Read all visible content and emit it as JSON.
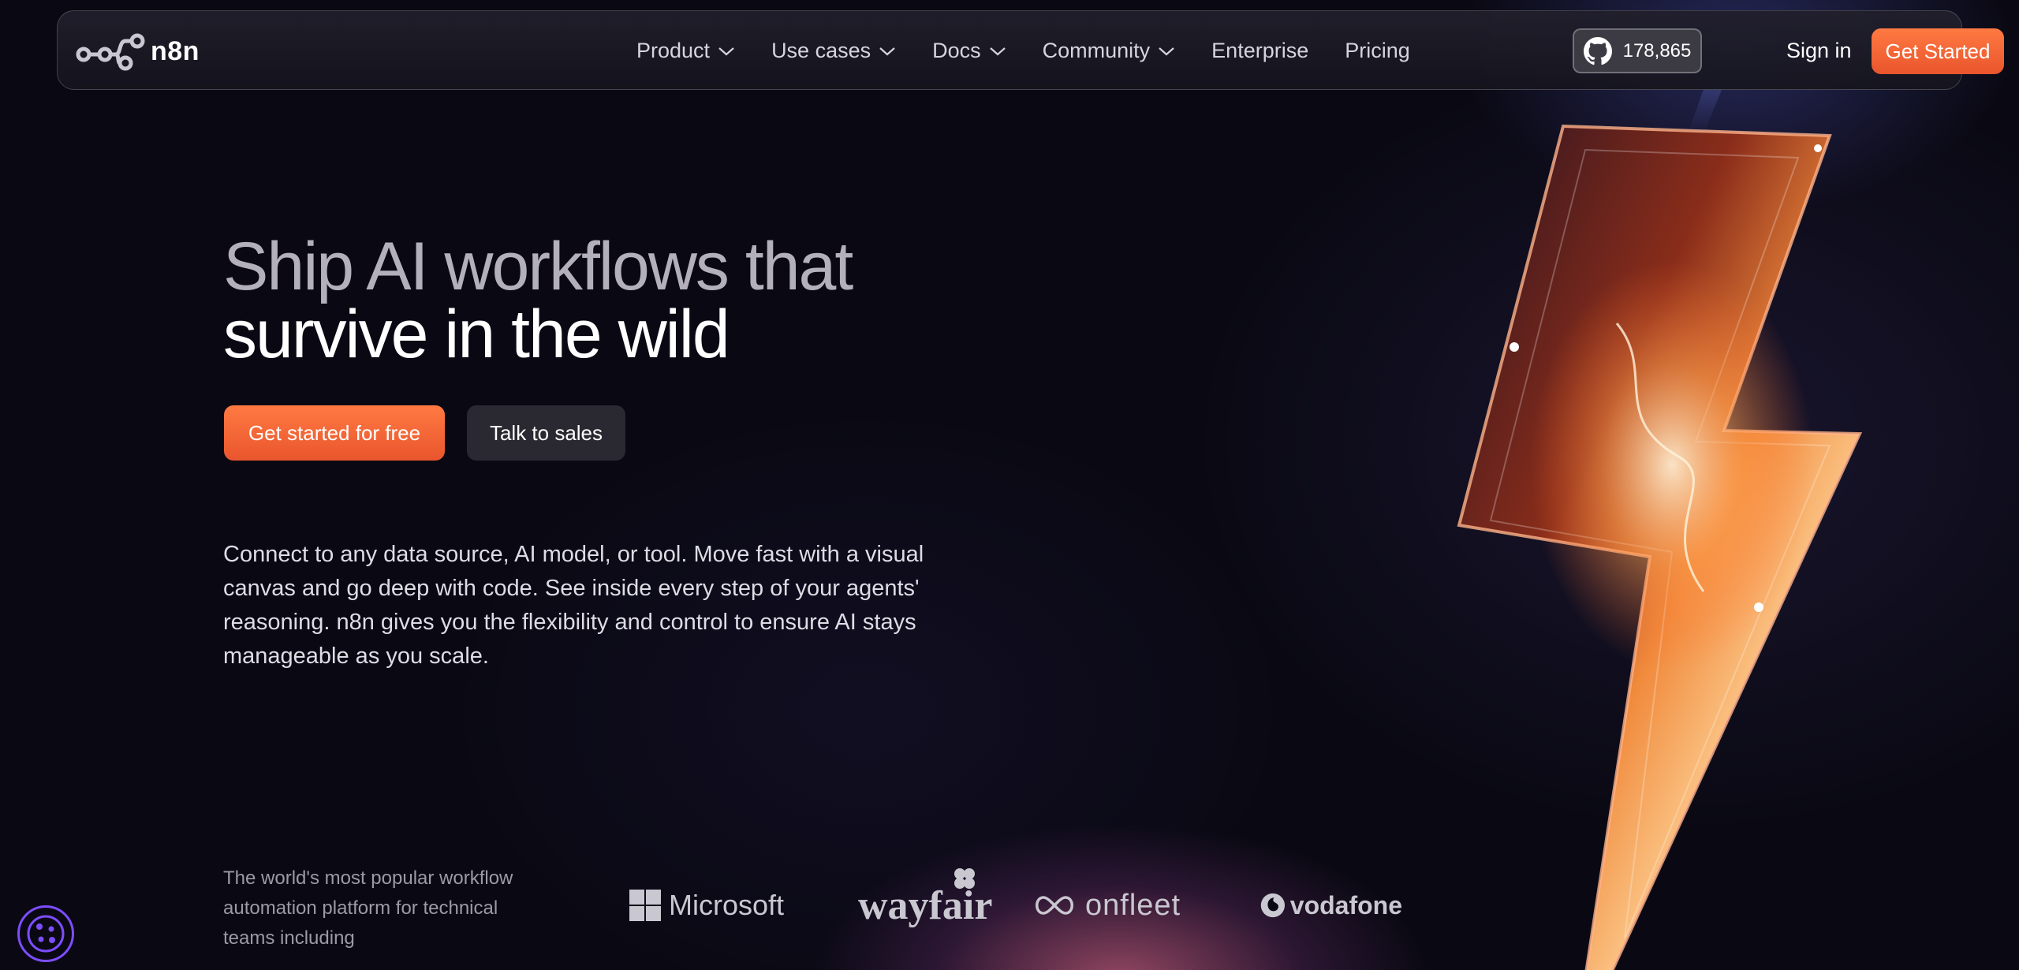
{
  "brand": {
    "name": "n8n",
    "accent_color": "#ff6d3a",
    "bg_color": "#0a0913"
  },
  "nav": {
    "items": [
      {
        "label": "Product",
        "has_dropdown": true
      },
      {
        "label": "Use cases",
        "has_dropdown": true
      },
      {
        "label": "Docs",
        "has_dropdown": true
      },
      {
        "label": "Community",
        "has_dropdown": true
      },
      {
        "label": "Enterprise",
        "has_dropdown": false
      },
      {
        "label": "Pricing",
        "has_dropdown": false
      }
    ],
    "github_stars": "178,865",
    "github_icon": "github-icon",
    "sign_in_label": "Sign in",
    "get_started_label": "Get Started"
  },
  "hero": {
    "title_line1": "Ship AI workflows that",
    "title_line2": "survive in the wild",
    "primary_cta": "Get started for free",
    "secondary_cta": "Talk to sales",
    "description": "Connect to any data source, AI model, or tool. Move fast with a visual canvas and go deep with code. See inside every step of your agents' reasoning. n8n gives you the flexibility and control to ensure AI stays manageable as you scale."
  },
  "trust": {
    "text": "The world's most popular workflow automation platform for technical teams including",
    "logos": [
      {
        "name": "Microsoft",
        "icon": "microsoft-logo"
      },
      {
        "name": "wayfair",
        "icon": "wayfair-logo"
      },
      {
        "name": "onfleet",
        "icon": "onfleet-logo"
      },
      {
        "name": "vodafone",
        "icon": "vodafone-logo"
      }
    ]
  },
  "cookie_icon": "cookie-icon"
}
